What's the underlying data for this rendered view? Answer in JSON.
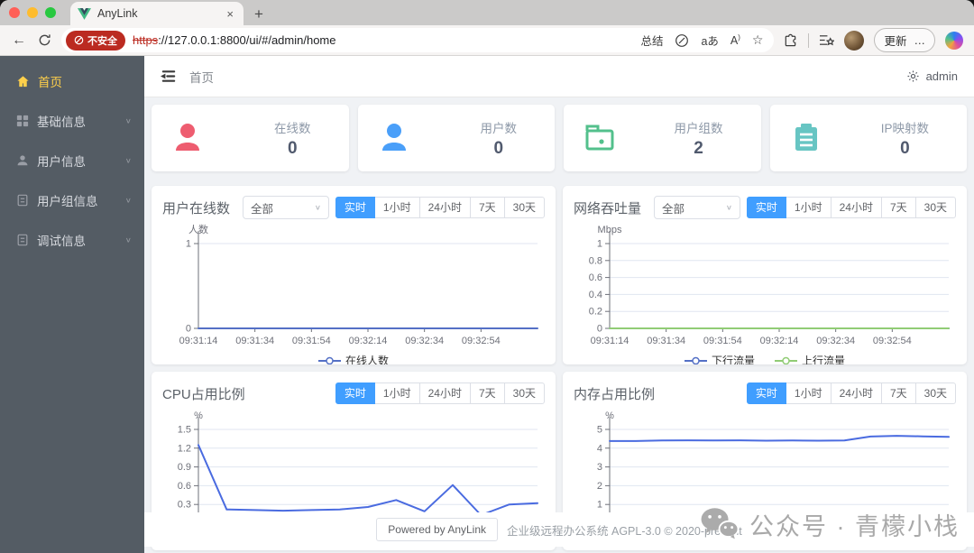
{
  "browser": {
    "tab_title": "AnyLink",
    "close_tab_label": "×",
    "new_tab_label": "+",
    "back_label": "←",
    "url_badge": "不安全",
    "url_scheme": "https",
    "url_rest": "://127.0.0.1:8800/ui/#/admin/home",
    "summarize_label": "总结",
    "translate_label": "aあ",
    "read_aloud_label": "A",
    "update_label": "更新",
    "more_label": "…"
  },
  "sidebar": {
    "items": [
      {
        "label": "首页",
        "active": true
      },
      {
        "label": "基础信息",
        "active": false
      },
      {
        "label": "用户信息",
        "active": false
      },
      {
        "label": "用户组信息",
        "active": false
      },
      {
        "label": "调试信息",
        "active": false
      }
    ]
  },
  "header": {
    "breadcrumb": "首页",
    "username": "admin"
  },
  "stats": [
    {
      "label": "在线数",
      "value": "0",
      "icon": "user-icon",
      "color": "#ee5d70"
    },
    {
      "label": "用户数",
      "value": "0",
      "icon": "user-icon",
      "color": "#4a9ff9"
    },
    {
      "label": "用户组数",
      "value": "2",
      "icon": "folder-icon",
      "color": "#53c08c"
    },
    {
      "label": "IP映射数",
      "value": "0",
      "icon": "clipboard-icon",
      "color": "#67c5c3"
    }
  ],
  "controls": {
    "select_value": "全部",
    "ranges": [
      "实时",
      "1小时",
      "24小时",
      "7天",
      "30天"
    ],
    "active_range": "实时",
    "accent_color": "#409EFF"
  },
  "chart_data": [
    {
      "type": "line",
      "title": "用户在线数",
      "has_select": true,
      "yname": "人数",
      "ylim": [
        0,
        1
      ],
      "yticks": [
        1,
        0
      ],
      "xlabels": [
        "09:31:14",
        "09:31:34",
        "09:31:54",
        "09:32:14",
        "09:32:34",
        "09:32:54"
      ],
      "series": [
        {
          "name": "在线人数",
          "color": "#5470C6",
          "values": [
            0,
            0,
            0,
            0,
            0,
            0,
            0
          ]
        }
      ],
      "legend": [
        "在线人数"
      ],
      "grid": true,
      "clipped": false
    },
    {
      "type": "line",
      "title": "网络吞吐量",
      "has_select": true,
      "yname": "Mbps",
      "ylim": [
        0,
        1
      ],
      "yticks": [
        1,
        0.8,
        0.6,
        0.4,
        0.2,
        0
      ],
      "xlabels": [
        "09:31:14",
        "09:31:34",
        "09:31:54",
        "09:32:14",
        "09:32:34",
        "09:32:54"
      ],
      "series": [
        {
          "name": "下行流量",
          "color": "#5470C6",
          "values": [
            0,
            0,
            0,
            0,
            0,
            0,
            0
          ]
        },
        {
          "name": "上行流量",
          "color": "#91CC75",
          "values": [
            0,
            0,
            0,
            0,
            0,
            0,
            0
          ]
        }
      ],
      "legend": [
        "下行流量",
        "上行流量"
      ],
      "grid": true,
      "clipped": false
    },
    {
      "type": "line",
      "title": "CPU占用比例",
      "has_select": false,
      "yname": "%",
      "ylim": [
        0,
        1.5
      ],
      "yticks": [
        1.5,
        1.2,
        0.9,
        0.6,
        0.3
      ],
      "xlabels": [],
      "series": [
        {
          "name": "",
          "color": "#4a6be0",
          "values": [
            1.25,
            0.22,
            0.21,
            0.2,
            0.21,
            0.22,
            0.26,
            0.37,
            0.19,
            0.61,
            0.13,
            0.3,
            0.32
          ]
        }
      ],
      "legend": [],
      "grid": true,
      "clipped": true
    },
    {
      "type": "line",
      "title": "内存占用比例",
      "has_select": false,
      "yname": "%",
      "ylim": [
        0,
        5
      ],
      "yticks": [
        5,
        4,
        3,
        2,
        1
      ],
      "xlabels": [],
      "series": [
        {
          "name": "",
          "color": "#4a6be0",
          "values": [
            4.38,
            4.38,
            4.41,
            4.42,
            4.41,
            4.42,
            4.4,
            4.41,
            4.4,
            4.41,
            4.62,
            4.66,
            4.63,
            4.6
          ]
        }
      ],
      "legend": [],
      "grid": true,
      "clipped": true
    }
  ],
  "footer": {
    "powered_by": "Powered by AnyLink",
    "license": "企业级远程办公系统 AGPL-3.0 © 2020-present"
  },
  "watermark": {
    "text": "公众号 · 青檬小栈"
  }
}
